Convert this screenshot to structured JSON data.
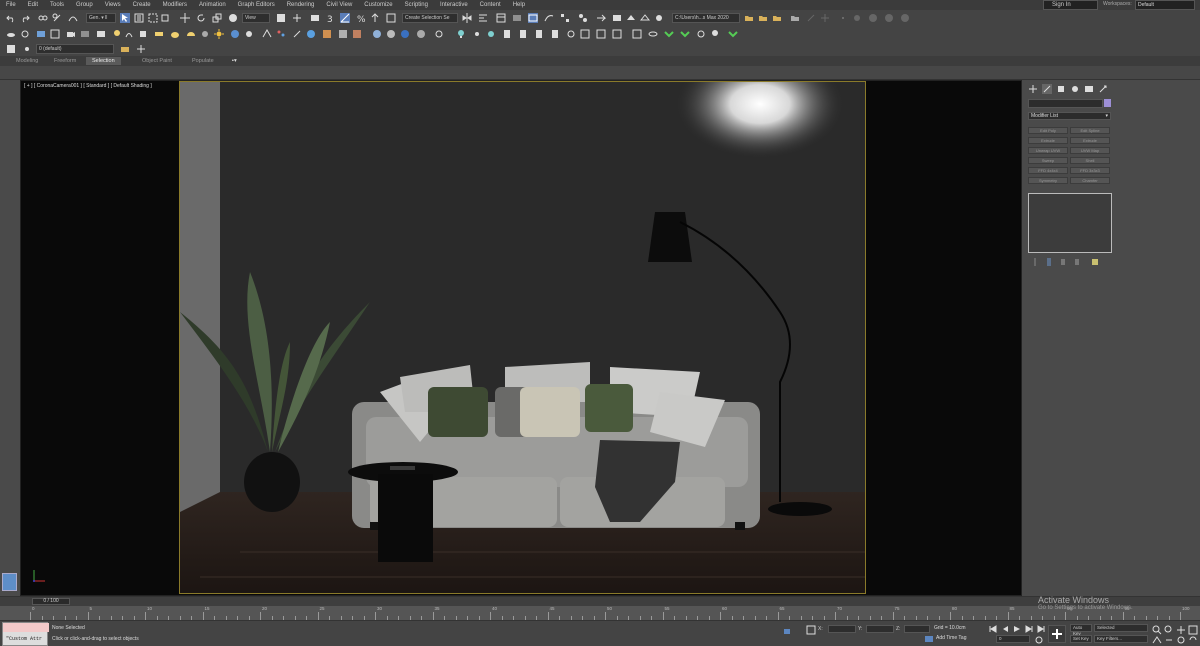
{
  "menu": [
    "File",
    "Edit",
    "Tools",
    "Group",
    "Views",
    "Create",
    "Modifiers",
    "Animation",
    "Graph Editors",
    "Rendering",
    "Civil View",
    "Customize",
    "Scripting",
    "Interactive",
    "Content",
    "Help"
  ],
  "account": {
    "sign_in": "Sign In",
    "workspaces_label": "Workspaces:",
    "workspace": "Default"
  },
  "toolbar": {
    "selection_filter": "Gen. ▾ ll",
    "reference_coord": "View",
    "named_selection": "Create Selection Se",
    "project_path": "C:\\Users\\h...s Max 2020",
    "layer": "0 (default)"
  },
  "ribbon_tabs": [
    "Modeling",
    "Freeform",
    "Selection",
    "Object Paint",
    "Populate"
  ],
  "ribbon_active": "Selection",
  "viewport": {
    "label": "[ + ] [ CoronaCamera001 ] [ Standard ] [ Default Shading ]",
    "scene_bg": "#2a2a2a",
    "frame_color": "#8a7a2a"
  },
  "command_panel": {
    "modifier_list": "Modifier List",
    "modifier_buttons": [
      "Edit Poly",
      "Edit Spline",
      "Extrude",
      "Extrude",
      "Unwrap UVW",
      "UVW Map",
      "Sweep",
      "Shell",
      "FFD 4x4x4",
      "FFD 3x3x3",
      "Symmetry",
      "Chamfer"
    ],
    "object_color": "#9d8fd6"
  },
  "timeline": {
    "slider": "0 / 100",
    "ticks": [
      "0",
      "5",
      "10",
      "15",
      "20",
      "25",
      "30",
      "35",
      "40",
      "45",
      "50",
      "55",
      "60",
      "65",
      "70",
      "75",
      "80",
      "85",
      "90",
      "95",
      "100"
    ]
  },
  "status": {
    "maxscript": "\"Custom Attr",
    "selection": "None Selected",
    "prompt": "Click or click-and-drag to select objects",
    "x_label": "X:",
    "y_label": "Y:",
    "z_label": "Z:",
    "grid": "Grid = 10.0cm",
    "add_time_tag": "Add Time Tag",
    "auto_key": "Auto Key",
    "set_key": "Set Key",
    "key_mode": "Selected",
    "key_filters": "Key Filters...",
    "frame": "0"
  },
  "watermark": {
    "title": "Activate Windows",
    "subtitle": "Go to Settings to activate Windows."
  }
}
